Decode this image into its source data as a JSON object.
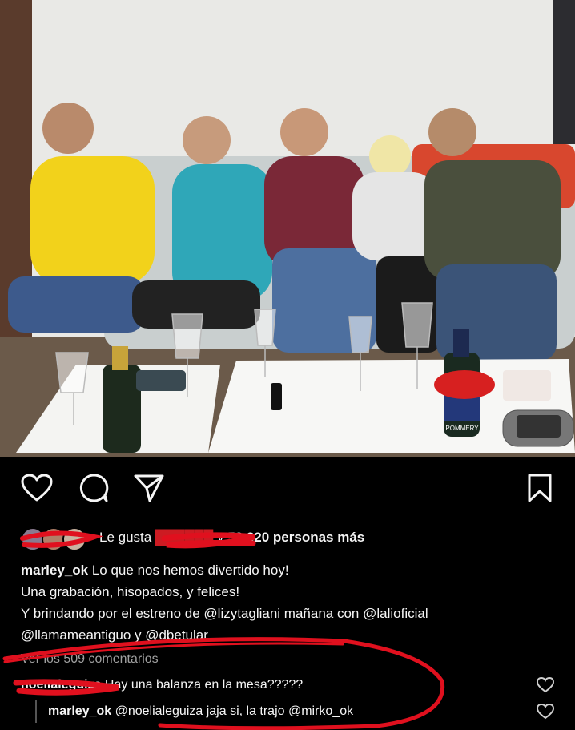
{
  "photo": {
    "bottle_label": "POMMERY"
  },
  "actions": {
    "like_icon": "heart-icon",
    "comment_icon": "comment-icon",
    "share_icon": "send-icon",
    "save_icon": "bookmark-icon"
  },
  "likes": {
    "prefix": "Le gusta",
    "redacted_user": "██████",
    "middle": " y ",
    "count_text": "53,320 personas más"
  },
  "caption": {
    "username": "marley_ok",
    "line1": " Lo que nos hemos divertido hoy!",
    "line2": "Una grabación, hisopados, y felices!",
    "line3": "Y brindando por el estreno de @lizytagliani mañana con @laliofi­cial",
    "line4": "@llamameantiguo y @dbetular"
  },
  "view_comments": "Ver los 509 comentarios",
  "comments": [
    {
      "username": "noelialeguiza",
      "text": " Hay una balanza en la mesa?????"
    },
    {
      "username": "marley_ok",
      "text": " @noelialeguiza jaja si, la trajo @mirko_ok"
    }
  ],
  "colors": {
    "background": "#000000",
    "text": "#f5f5f5",
    "muted": "#a0a0a0",
    "scribble": "#e0101e"
  }
}
